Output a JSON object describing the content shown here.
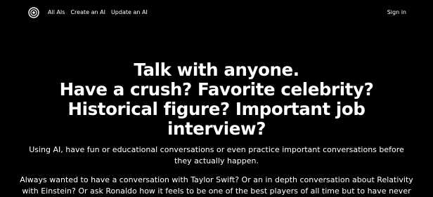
{
  "nav": {
    "logo_icon": "circle-logo-icon",
    "links": [
      "All AIs",
      "Create an AI",
      "Update an AI"
    ],
    "signin_label": "Sign in"
  },
  "hero": {
    "title_lines": [
      "Talk with anyone.",
      "Have a crush? Favorite celebrity?",
      "Historical figure? Important job",
      "interview?"
    ],
    "subtitle": "Using AI, have fun or educational conversations or even practice important conversations before they actually happen.",
    "body": "Always wanted to have a conversation with Taylor Swift? Or an in depth conversation about Relativity with Einstein? Or ask Ronaldo how it feels to be one of the best players of all time but to have never"
  },
  "colors": {
    "background": "#000000",
    "text": "#ffffff"
  }
}
